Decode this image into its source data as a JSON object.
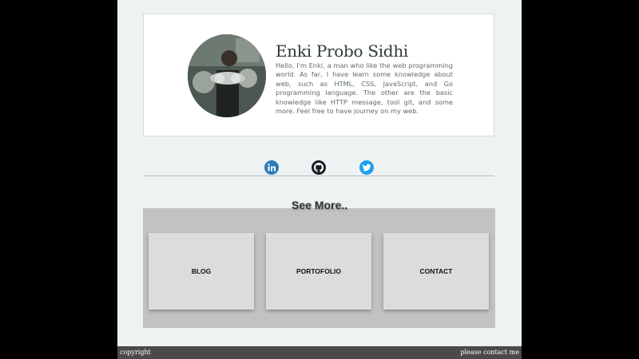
{
  "profile": {
    "name": "Enki Probo Sidhi",
    "bio": "Hello, I'm Enki, a man who like the web programming world. As far, I have learn some knowledge about web, such as HTML, CSS, JavaScript, and Go programming language. The other are the basic knowledge like HTTP message, tool git, and some more. Feel free to have journey on my web."
  },
  "social": [
    {
      "icon": "linkedin-icon",
      "color": "#2b7bb9"
    },
    {
      "icon": "github-icon",
      "color": "#1b1f23"
    },
    {
      "icon": "twitter-icon",
      "color": "#1da1f2"
    }
  ],
  "see_more": {
    "title": "See More..",
    "cards": [
      "BLOG",
      "PORTOFOLIO",
      "CONTACT"
    ]
  },
  "footer": {
    "left": "copyright",
    "right": "please contact me"
  },
  "colors": {
    "page_bg": "#eef2f3",
    "panel_bg": "#c0c2c3",
    "card_bg": "#dcdcdc",
    "footer_bg": "#4a4a4a"
  }
}
